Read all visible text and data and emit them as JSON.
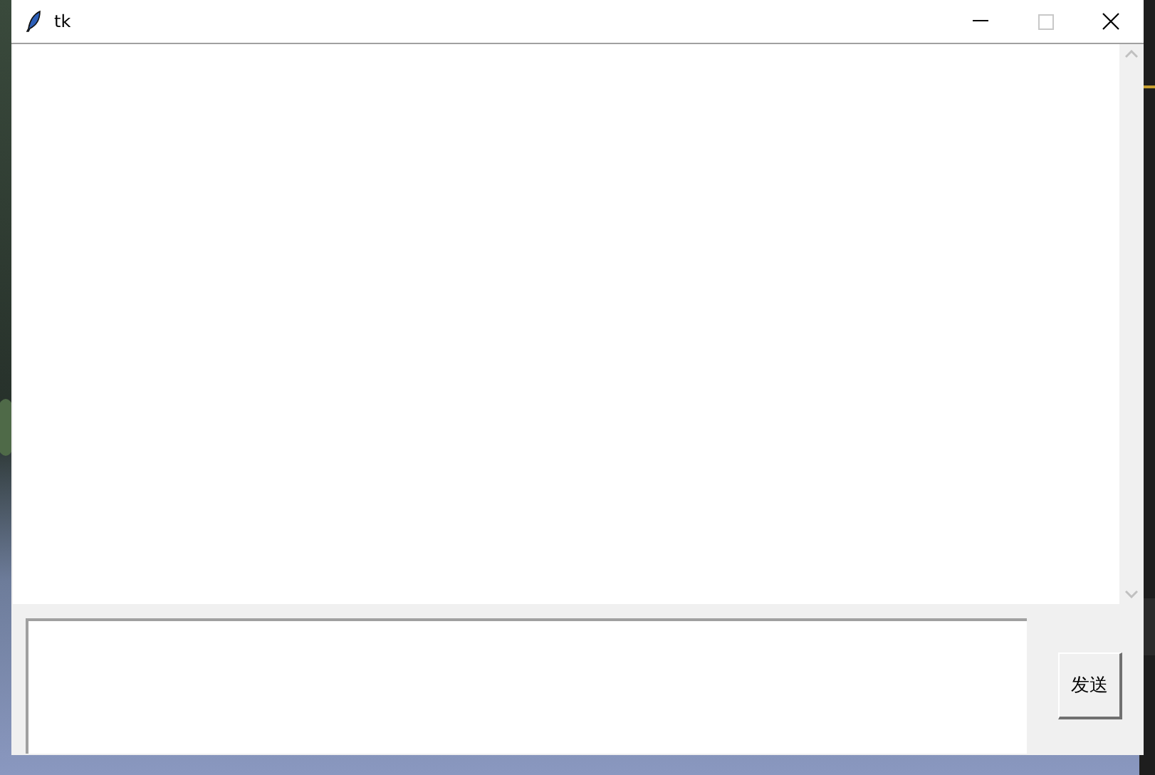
{
  "window": {
    "title": "tk"
  },
  "send_button": {
    "label": "发送"
  }
}
